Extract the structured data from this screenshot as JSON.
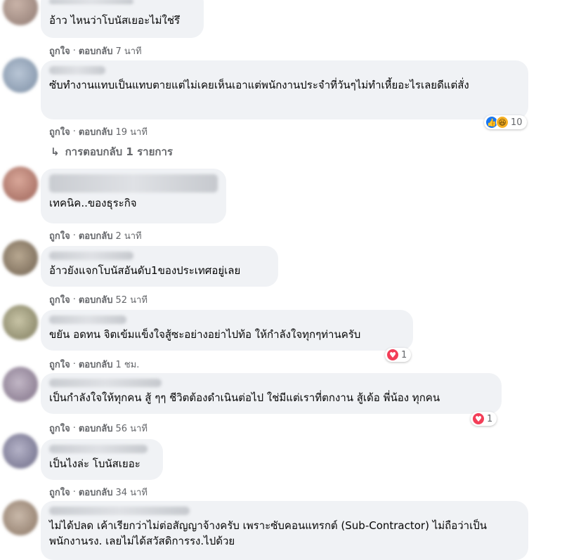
{
  "action_like": "ถูกใจ",
  "action_reply": "ตอบกลับ",
  "separator": "·",
  "comments": [
    {
      "text": "อ้าว ไหนว่าโบนัสเยอะไม่ใช่รึ",
      "time": "7 นาที"
    },
    {
      "text": "ซับทำงานแทบเป็นแทบตายแต่ไม่เคยเห็นเอาแต่พนักงานประจำที่วันๆไม่ทำเหี้ยอะไรเลยดีแต่สั่ง",
      "time": "19 นาที",
      "reaction_count": "10",
      "reactions": [
        "like-icon",
        "haha-icon"
      ]
    },
    {
      "text": "เทคนิค..ของธุระกิจ",
      "time": "2 นาที"
    },
    {
      "text": "อ้าวยังแจกโบนัสอันดับ1ของประเทศอยู่เลย",
      "time": "52 นาที"
    },
    {
      "text": "ขยัน อดทน จิตเข้มแข็งใจสู้ซะอย่างอย่าไปท้อ ให้กำลังใจทุกๆท่านครับ",
      "time": "1 ชม.",
      "reaction_count": "1",
      "reactions": [
        "love-icon"
      ]
    },
    {
      "text": "เป็นกำลังใจให้ทุกคน สู้ ๆๆ ชีวิตต้องดำเนินต่อไป ใช่มีแต่เราที่ตกงาน สู้เด้อ พี่น้อง ทุกคน",
      "time": "56 นาที",
      "reaction_count": "1",
      "reactions": [
        "love-icon"
      ]
    },
    {
      "text": "เป็นไงล่ะ โบนัสเยอะ",
      "time": "34 นาที"
    },
    {
      "text": "ไม่ได้ปลด เค้าเรียกว่าไม่ต่อสัญญาจ้างครับ เพราะซับคอนแทรกต์ (Sub-Contractor) ไม่ถือว่าเป็นพนักงานรง. เลยไม่ได้สวัสดิการรง.ไปด้วย"
    }
  ],
  "replies_link": "การตอบกลับ 1 รายการ",
  "colors": {
    "bubble": "#f0f2f5",
    "meta": "#65676b",
    "like": "#1877f2",
    "love": "#f33e58",
    "haha": "#f7b125"
  }
}
